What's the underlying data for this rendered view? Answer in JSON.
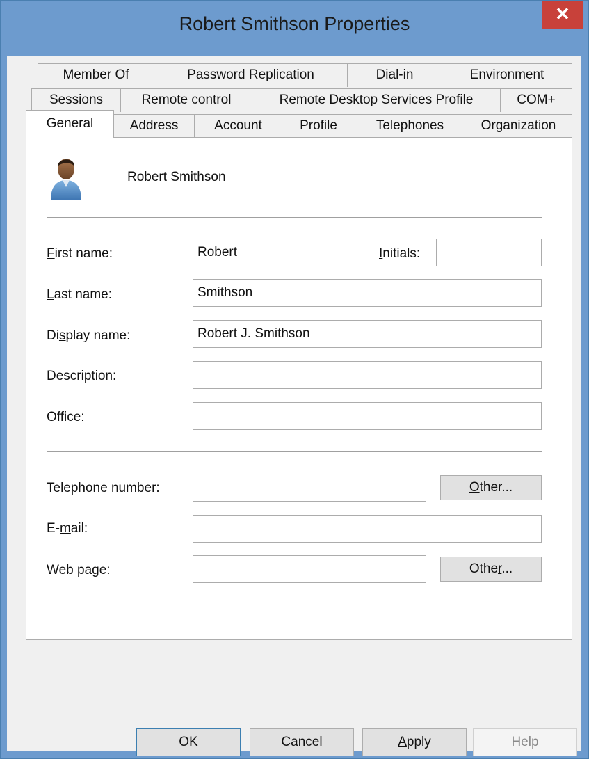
{
  "window": {
    "title": "Robert Smithson Properties",
    "close_glyph": "✕"
  },
  "tabs": {
    "row1": [
      "Member Of",
      "Password Replication",
      "Dial-in",
      "Environment"
    ],
    "row2": [
      "Sessions",
      "Remote control",
      "Remote Desktop Services Profile",
      "COM+"
    ],
    "row3": [
      "General",
      "Address",
      "Account",
      "Profile",
      "Telephones",
      "Organization"
    ],
    "active": "General"
  },
  "general": {
    "user_icon": "user-icon",
    "user_name": "Robert Smithson",
    "labels": {
      "first_name": {
        "accel": "F",
        "rest": "irst name:"
      },
      "initials": {
        "accel": "I",
        "rest": "nitials:"
      },
      "last_name": {
        "accel": "L",
        "rest": "ast name:"
      },
      "display_name": {
        "pre": "Di",
        "accel": "s",
        "rest": "play name:"
      },
      "description": {
        "accel": "D",
        "rest": "escription:"
      },
      "office": {
        "pre": "Offi",
        "accel": "c",
        "rest": "e:"
      },
      "telephone": {
        "accel": "T",
        "rest": "elephone number:"
      },
      "email": {
        "pre": "E-",
        "accel": "m",
        "rest": "ail:"
      },
      "web_page": {
        "accel": "W",
        "rest": "eb page:"
      }
    },
    "values": {
      "first_name": "Robert",
      "initials": "",
      "last_name": "Smithson",
      "display_name": "Robert J. Smithson",
      "description": "",
      "office": "",
      "telephone": "",
      "email": "",
      "web_page": ""
    },
    "other_phone": {
      "accel": "O",
      "rest": "ther..."
    },
    "other_web": {
      "pre": "Othe",
      "accel": "r",
      "rest": "..."
    }
  },
  "footer": {
    "ok": "OK",
    "cancel": "Cancel",
    "apply": {
      "accel": "A",
      "rest": "pply"
    },
    "help": "Help"
  },
  "colors": {
    "titlebar": "#6d9bce",
    "close": "#c8413a",
    "focus_border": "#569de5",
    "dialog_bg": "#f0f0f0"
  }
}
